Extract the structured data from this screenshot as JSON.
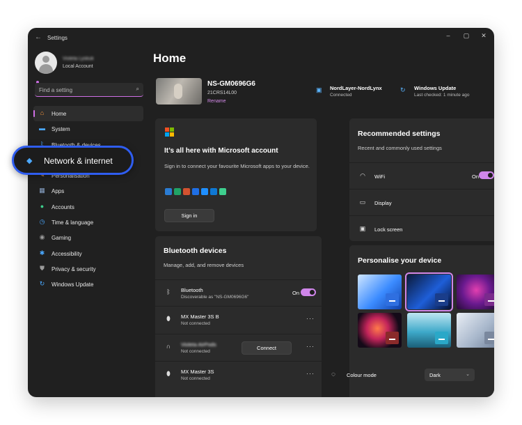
{
  "window": {
    "title": "Settings",
    "back_icon": "←",
    "minimize": "–",
    "maximize": "▢",
    "close": "✕"
  },
  "profile": {
    "name": "Violeta Lyskuk",
    "account_type": "Local Account"
  },
  "search": {
    "placeholder": "Find a setting",
    "icon": "⌕"
  },
  "nav": [
    {
      "label": "Home",
      "icon": "home-icon",
      "glyph": "⌂",
      "color": "#ff9a3c"
    },
    {
      "label": "System",
      "icon": "monitor-icon",
      "glyph": "▬",
      "color": "#4aa8ff"
    },
    {
      "label": "Bluetooth & devices",
      "icon": "bluetooth-icon",
      "glyph": "ᛒ",
      "color": "#4aa8ff"
    },
    {
      "label": "Network & internet",
      "icon": "wifi-icon",
      "glyph": "◆",
      "color": "#4aa8ff"
    },
    {
      "label": "Personalisation",
      "icon": "brush-icon",
      "glyph": "✎",
      "color": "#f2a65a"
    },
    {
      "label": "Apps",
      "icon": "apps-icon",
      "glyph": "▦",
      "color": "#8aa4c8"
    },
    {
      "label": "Accounts",
      "icon": "person-icon",
      "glyph": "●",
      "color": "#3ecf8e"
    },
    {
      "label": "Time & language",
      "icon": "globe-clock-icon",
      "glyph": "◷",
      "color": "#4aa8ff"
    },
    {
      "label": "Gaming",
      "icon": "gamepad-icon",
      "glyph": "◉",
      "color": "#9a9a9a"
    },
    {
      "label": "Accessibility",
      "icon": "accessibility-icon",
      "glyph": "✱",
      "color": "#4aa8ff"
    },
    {
      "label": "Privacy & security",
      "icon": "shield-icon",
      "glyph": "⛊",
      "color": "#9a9a9a"
    },
    {
      "label": "Windows Update",
      "icon": "update-icon",
      "glyph": "↻",
      "color": "#4aa8ff"
    }
  ],
  "callout": {
    "label": "Network & internet",
    "icon": "wifi-icon"
  },
  "main": {
    "title": "Home"
  },
  "device": {
    "name": "NS-GM0696G6",
    "model": "21CRS14L00",
    "rename": "Rename"
  },
  "status": [
    {
      "title": "NordLayer-NordLynx",
      "sub": "Connected",
      "icon": "network-icon",
      "glyph": "▣"
    },
    {
      "title": "Windows Update",
      "sub": "Last checked: 1 minute ago",
      "icon": "update-icon",
      "glyph": "↻"
    }
  ],
  "ms_account": {
    "title": "It’s all here with Microsoft account",
    "desc": "Sign in to connect your favourite Microsoft apps to your device.",
    "button": "Sign in",
    "apps": [
      "word-icon",
      "excel-icon",
      "powerpoint-icon",
      "defender-icon",
      "onedrive-icon",
      "outlook-icon",
      "family-icon"
    ],
    "app_colors": [
      "#2b7cd3",
      "#21a366",
      "#d35230",
      "#1f6fe5",
      "#1f8fff",
      "#0f78d4",
      "#3ecf8e"
    ]
  },
  "bluetooth": {
    "title": "Bluetooth devices",
    "desc": "Manage, add, and remove devices",
    "on_label": "On",
    "connect_label": "Connect",
    "more": "···",
    "rows": [
      {
        "name": "Bluetooth",
        "sub": "Discoverable as \"NS-GM0696G6\"",
        "icon": "bluetooth-icon",
        "glyph": "ᛒ"
      },
      {
        "name": "MX Master 3S B",
        "sub": "Not connected",
        "icon": "mouse-icon",
        "glyph": "⬮"
      },
      {
        "name": "Violeta AirPods",
        "sub": "Not connected",
        "icon": "headphones-icon",
        "glyph": "∩"
      },
      {
        "name": "MX Master 3S",
        "sub": "Not connected",
        "icon": "mouse-icon",
        "glyph": "⬮"
      }
    ]
  },
  "recommended": {
    "title": "Recommended settings",
    "desc": "Recent and commonly used settings",
    "on_label": "On",
    "chevron": "›",
    "rows": [
      {
        "label": "WiFi",
        "icon": "wifi-icon",
        "glyph": "◠"
      },
      {
        "label": "Display",
        "icon": "display-icon",
        "glyph": "▭"
      },
      {
        "label": "Lock screen",
        "icon": "lock-screen-icon",
        "glyph": "▣"
      }
    ]
  },
  "personalise": {
    "title": "Personalise your device",
    "colour_mode_label": "Colour mode",
    "colour_mode_icon": "palette-icon",
    "colour_mode_value": "Dark",
    "themes": [
      {
        "bg": "linear-gradient(135deg,#cfe6ff,#3b8bff 55%,#0f3fa8)",
        "badge": "#2f6fe0",
        "selected": false
      },
      {
        "bg": "linear-gradient(135deg,#0b1a3a,#1e5ed8 55%,#061030)",
        "badge": "#1a3d8a",
        "selected": true
      },
      {
        "bg": "radial-gradient(circle at 45% 45%,#e23fb0,#6a1a8f 45%,#150822)",
        "badge": "#7a2a8c",
        "selected": false
      },
      {
        "bg": "radial-gradient(circle at 45% 45%,#ff7a4a,#c2245a 35%,#140a18 70%)",
        "badge": "#8a2a2a",
        "selected": false
      },
      {
        "bg": "linear-gradient(180deg,#bfe6f2,#3ea9c9 55%,#1b5f78)",
        "badge": "#2aa8c8",
        "selected": false
      },
      {
        "bg": "linear-gradient(135deg,#e9eef5,#a9b8cc 55%,#6e7f98)",
        "badge": "#7a889e",
        "selected": false
      }
    ]
  }
}
